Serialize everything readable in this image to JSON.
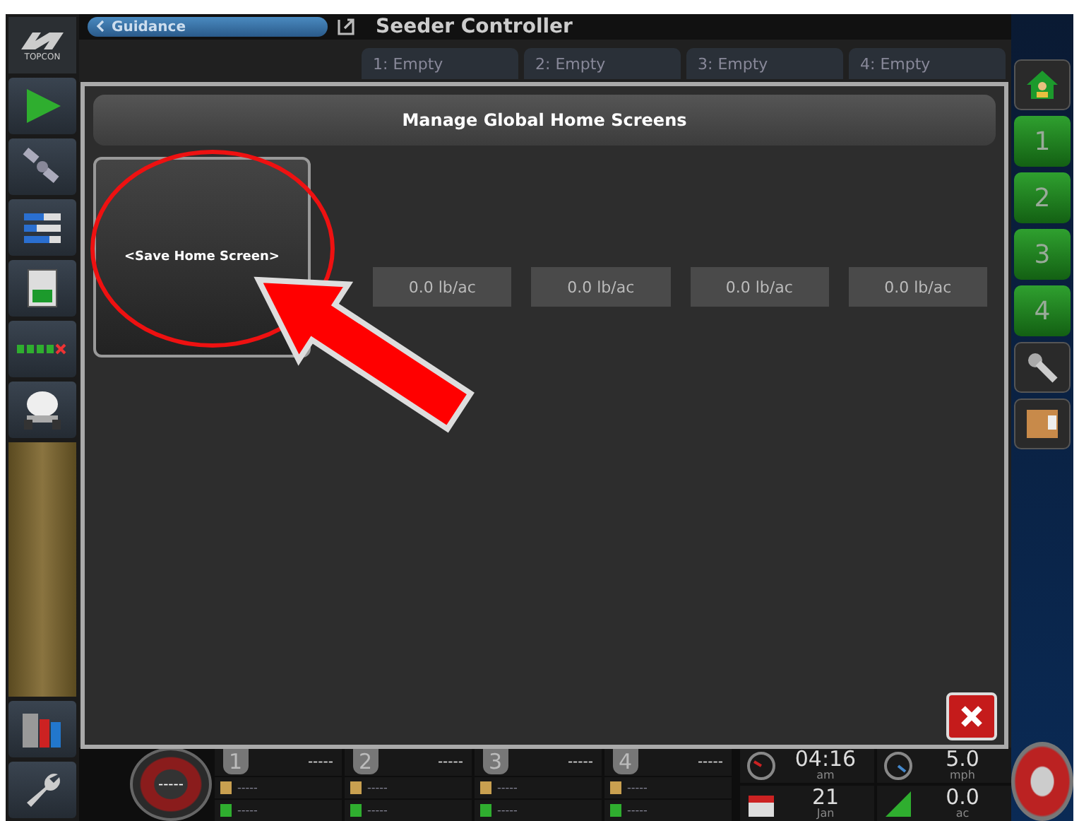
{
  "left_sidebar": {
    "logo": "TOPCON",
    "buttons": [
      {
        "kind": "guidance"
      },
      {
        "kind": "satellite"
      },
      {
        "kind": "bars"
      },
      {
        "kind": "monitor"
      },
      {
        "kind": "status"
      },
      {
        "kind": "vehicle"
      }
    ],
    "bottom_buttons": [
      {
        "kind": "bins"
      },
      {
        "kind": "wrench"
      }
    ]
  },
  "top_bar": {
    "back_tab": "Guidance",
    "title": "Seeder Controller"
  },
  "product_tabs": [
    {
      "label": "1: Empty"
    },
    {
      "label": "2: Empty"
    },
    {
      "label": "3: Empty"
    },
    {
      "label": "4: Empty"
    }
  ],
  "rate_fields": [
    "0.0 lb/ac",
    "0.0 lb/ac",
    "0.0 lb/ac",
    "0.0 lb/ac"
  ],
  "dialog": {
    "title": "Manage Global Home Screens",
    "save_button": "<Save Home Screen>"
  },
  "right_sidebar": {
    "buttons": [
      {
        "kind": "home"
      },
      {
        "kind": "number",
        "label": "1"
      },
      {
        "kind": "number",
        "label": "2"
      },
      {
        "kind": "number",
        "label": "3"
      },
      {
        "kind": "number",
        "label": "4"
      },
      {
        "kind": "tools"
      },
      {
        "kind": "layout"
      }
    ]
  },
  "bottom_bar": {
    "gauge": "-----",
    "bins": [
      {
        "number": "1",
        "reading": "-----",
        "line_1": "-----",
        "line_2": "-----"
      },
      {
        "number": "2",
        "reading": "-----",
        "line_1": "-----",
        "line_2": "-----"
      },
      {
        "number": "3",
        "reading": "-----",
        "line_1": "-----",
        "line_2": "-----"
      },
      {
        "number": "4",
        "reading": "-----",
        "line_1": "-----",
        "line_2": "-----"
      }
    ],
    "time": "04:16",
    "ampm": "am",
    "day": "21",
    "month": "Jan",
    "speed": "5.0",
    "speed_unit": "mph",
    "area": "0.0",
    "area_unit": "ac"
  }
}
